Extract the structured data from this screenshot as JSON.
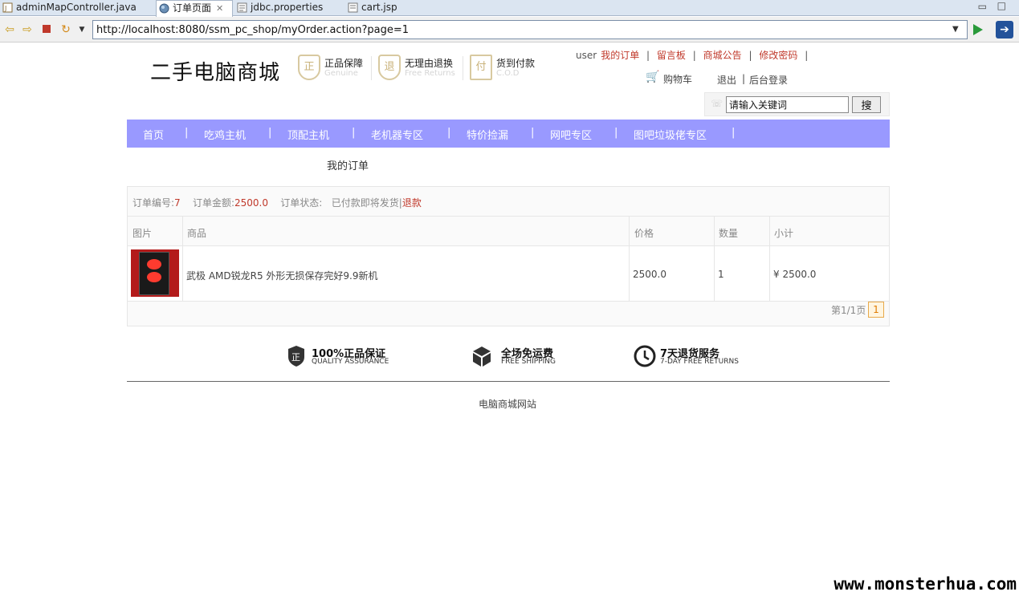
{
  "editor_tabs": [
    {
      "label": "adminMapController.java",
      "icon": "java-file-icon"
    },
    {
      "label": "订单页面",
      "icon": "globe-icon",
      "active": true
    },
    {
      "label": "jdbc.properties",
      "icon": "properties-file-icon"
    },
    {
      "label": "cart.jsp",
      "icon": "jsp-file-icon"
    }
  ],
  "window": {
    "minimize": "▭",
    "maximize": "□"
  },
  "toolbar": {
    "url": "http://localhost:8080/ssm_pc_shop/myOrder.action?page=1"
  },
  "site": {
    "title": "二手电脑商城",
    "badges": [
      {
        "title": "正品保障",
        "subtitle": "Genuine",
        "glyph": "正"
      },
      {
        "title": "无理由退换",
        "subtitle": "Free Returns",
        "glyph": "退"
      },
      {
        "title": "货到付款",
        "subtitle": "C.O.D",
        "glyph": "付"
      }
    ]
  },
  "user_links": {
    "username": "user",
    "my_orders": "我的订单",
    "message_board": "留言板",
    "announcement": "商城公告",
    "change_password": "修改密码",
    "separator": "|",
    "cart": "购物车",
    "logout": "退出",
    "admin_login": "后台登录"
  },
  "search": {
    "placeholder": "请输入关键词",
    "button": "搜"
  },
  "nav": [
    "首页",
    "吃鸡主机",
    "顶配主机",
    "老机器专区",
    "特价捡漏",
    "网吧专区",
    "图吧垃圾佬专区"
  ],
  "orders": {
    "heading": "我的订单",
    "order_no_label": "订单编号:",
    "order_no": "7",
    "amount_label": "订单金额:",
    "amount": "2500.0",
    "status_label": "订单状态:",
    "status": "已付款即将发货|",
    "refund": "退款",
    "columns": {
      "image": "图片",
      "product": "商品",
      "price": "价格",
      "qty": "数量",
      "subtotal": "小计"
    },
    "items": [
      {
        "name": "武极 AMD锐龙R5 外形无损保存完好9.9新机",
        "price": "2500.0",
        "qty": "1",
        "subtotal": "¥ 2500.0"
      }
    ],
    "page_label": "第1/1页",
    "page_current": "1"
  },
  "services": [
    {
      "title": "100%正品保证",
      "subtitle": "QUALITY ASSURANCE",
      "icon": "shield-icon"
    },
    {
      "title": "全场免运费",
      "subtitle": "FREE SHIPPING",
      "icon": "box-icon"
    },
    {
      "title": "7天退货服务",
      "subtitle": "7-DAY FREE RETURNS",
      "icon": "clock-icon"
    }
  ],
  "footer": {
    "text": "电脑商城网站"
  },
  "watermark": "www.monsterhua.com",
  "colors": {
    "nav_bg": "#9999ff",
    "link_red": "#c0392b"
  }
}
